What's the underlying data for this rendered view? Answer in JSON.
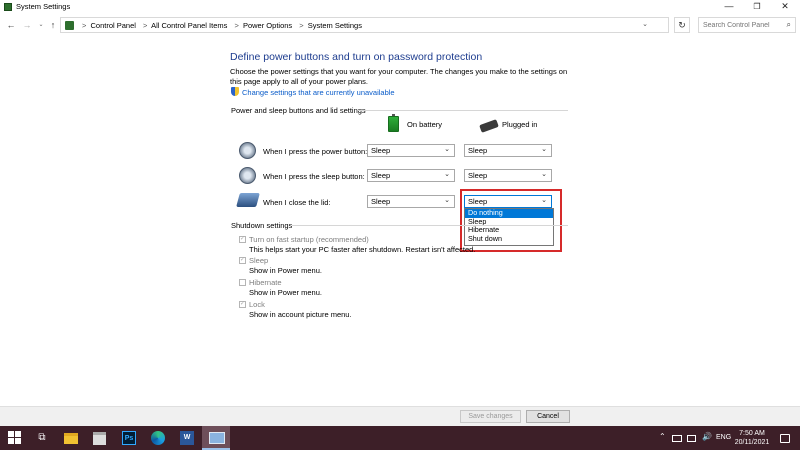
{
  "window": {
    "title": "System Settings",
    "min_glyph": "—",
    "max_glyph": "❐",
    "close_glyph": "✕"
  },
  "address": {
    "back_glyph": "←",
    "forward_glyph": "→",
    "recent_glyph": "⌄",
    "up_glyph": "↑",
    "refresh_glyph": "↻",
    "dropdown_glyph": "⌄",
    "breadcrumbs": [
      "Control Panel",
      "All Control Panel Items",
      "Power Options",
      "System Settings"
    ],
    "separator": ">",
    "search_placeholder": "Search Control Panel",
    "search_glyph": "⌕"
  },
  "page": {
    "heading": "Define power buttons and turn on password protection",
    "description": "Choose the power settings that you want for your computer. The changes you make to the settings on this page apply to all of your power plans.",
    "change_link": "Change settings that are currently unavailable",
    "section1": "Power and sleep buttons and lid settings",
    "col_battery": "On battery",
    "col_plugged": "Plugged in",
    "rows": [
      {
        "label": "When I press the power button:",
        "battery": "Sleep",
        "plugged": "Sleep"
      },
      {
        "label": "When I press the sleep button:",
        "battery": "Sleep",
        "plugged": "Sleep"
      },
      {
        "label": "When I close the lid:",
        "battery": "Sleep",
        "plugged": "Sleep"
      }
    ],
    "dropdown_arrow": "⌄",
    "lid_options": [
      "Do nothing",
      "Sleep",
      "Hibernate",
      "Shut down"
    ],
    "section2": "Shutdown settings",
    "shutdown": [
      {
        "label": "Turn on fast startup (recommended)",
        "desc": "This helps start your PC faster after shutdown. Restart isn't affected.",
        "checked": true
      },
      {
        "label": "Sleep",
        "desc": "Show in Power menu.",
        "checked": true
      },
      {
        "label": "Hibernate",
        "desc": "Show in Power menu.",
        "checked": false
      },
      {
        "label": "Lock",
        "desc": "Show in account picture menu.",
        "checked": true
      }
    ],
    "check_glyph": "✓"
  },
  "footer": {
    "save_label": "Save changes",
    "cancel_label": "Cancel"
  },
  "taskbar": {
    "task_view_glyph": "⧉",
    "ps_label": "Ps",
    "word_label": "W",
    "tray_caret": "⌃",
    "volume_glyph": "🔊",
    "language": "ENG",
    "time": "7:50 AM",
    "date": "20/11/2021"
  },
  "colors": {
    "heading": "#1e3d8f",
    "link": "#0a5cc9",
    "highlight": "#d62a2a",
    "selection": "#0078d7",
    "taskbar": "#3d1f28"
  }
}
